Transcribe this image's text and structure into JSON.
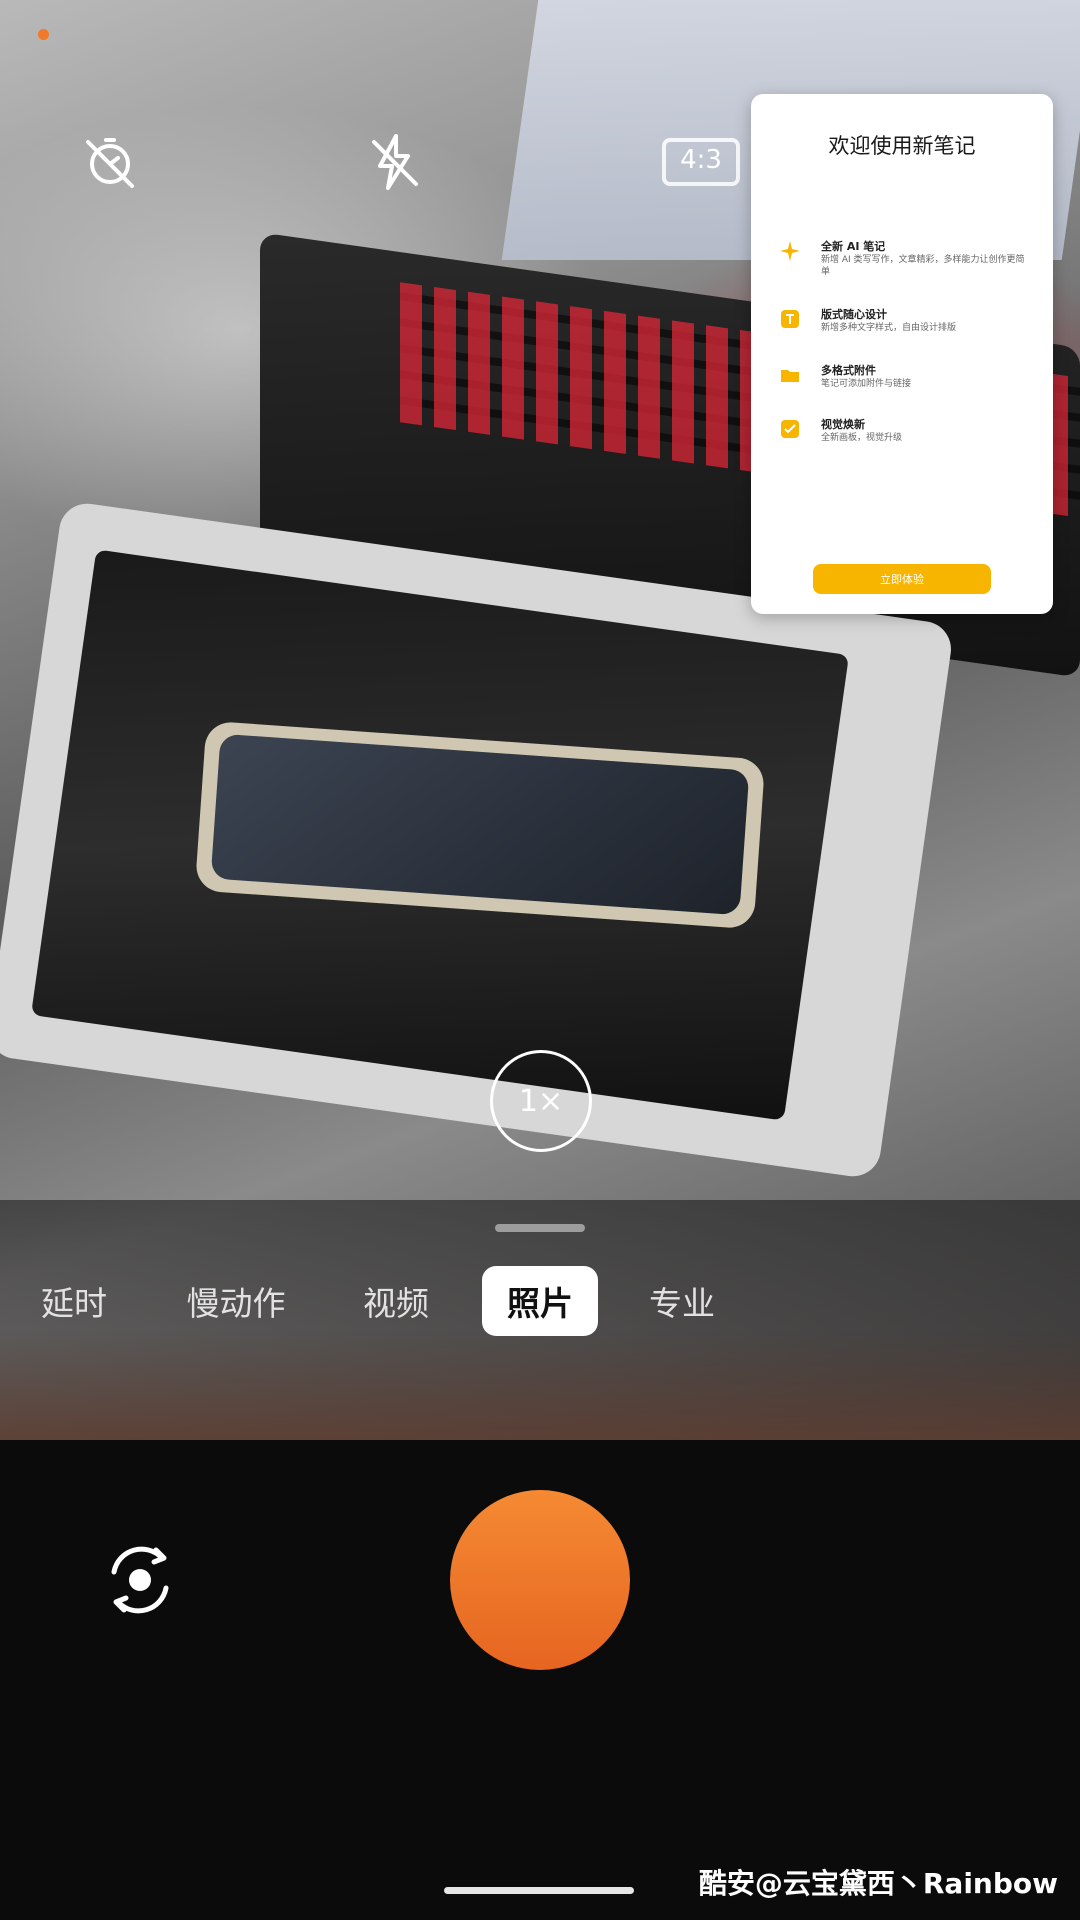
{
  "camera": {
    "zoom_label": "1×",
    "modes": [
      {
        "label": "延时"
      },
      {
        "label": "慢动作"
      },
      {
        "label": "视频"
      },
      {
        "label": "照片"
      },
      {
        "label": "专业"
      }
    ],
    "active_mode": "照片",
    "ratio_label": "4:3"
  },
  "popup": {
    "title": "欢迎使用新笔记",
    "features": [
      {
        "title": "全新 AI 笔记",
        "desc": "新增 AI 类写写作，文章精彩，多样能力让创作更简单"
      },
      {
        "title": "版式随心设计",
        "desc": "新增多种文字样式，自由设计排版"
      },
      {
        "title": "多格式附件",
        "desc": "笔记可添加附件与链接"
      },
      {
        "title": "视觉焕新",
        "desc": "全新画板，视觉升级"
      }
    ],
    "cta": "立即体验"
  },
  "watermark": "酷安@云宝黛西丶Rainbow",
  "colors": {
    "accent": "#f07a2a",
    "shutter": "#f58a33",
    "cta": "#f7b500"
  },
  "icons": [
    "timer-off-icon",
    "flash-off-icon",
    "aspect-ratio-icon",
    "switch-camera-icon"
  ]
}
